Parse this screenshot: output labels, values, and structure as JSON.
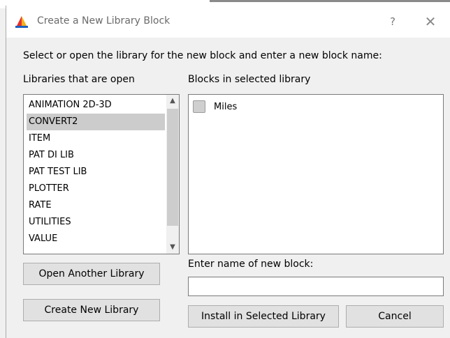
{
  "dialog": {
    "title": "Create a New Library Block",
    "help_label": "?",
    "close_label": "✕",
    "instruction": "Select or open the library for the new block and enter a new block name:"
  },
  "libraries": {
    "label": "Libraries that are open",
    "items": [
      {
        "label": "ANIMATION 2D-3D",
        "selected": false
      },
      {
        "label": "CONVERT2",
        "selected": true
      },
      {
        "label": "ITEM",
        "selected": false
      },
      {
        "label": "PAT DI LIB",
        "selected": false
      },
      {
        "label": "PAT TEST LIB",
        "selected": false
      },
      {
        "label": "PLOTTER",
        "selected": false
      },
      {
        "label": "RATE",
        "selected": false
      },
      {
        "label": "UTILITIES",
        "selected": false
      },
      {
        "label": "VALUE",
        "selected": false
      }
    ]
  },
  "blocks": {
    "label": "Blocks in selected library",
    "items": [
      {
        "label": "Miles",
        "icon": "block-icon"
      }
    ]
  },
  "new_block": {
    "label": "Enter name of new block:",
    "value": "",
    "placeholder": ""
  },
  "buttons": {
    "open_library": "Open Another Library",
    "create_library": "Create New Library",
    "install": "Install in Selected Library",
    "cancel": "Cancel"
  },
  "icons": {
    "app": "app-logo-icon",
    "scroll_up": "chevron-up-icon",
    "scroll_down": "chevron-down-icon"
  },
  "colors": {
    "dialog_bg": "#f0f0f0",
    "selection": "#cccccc",
    "button_bg": "#e1e1e1"
  }
}
